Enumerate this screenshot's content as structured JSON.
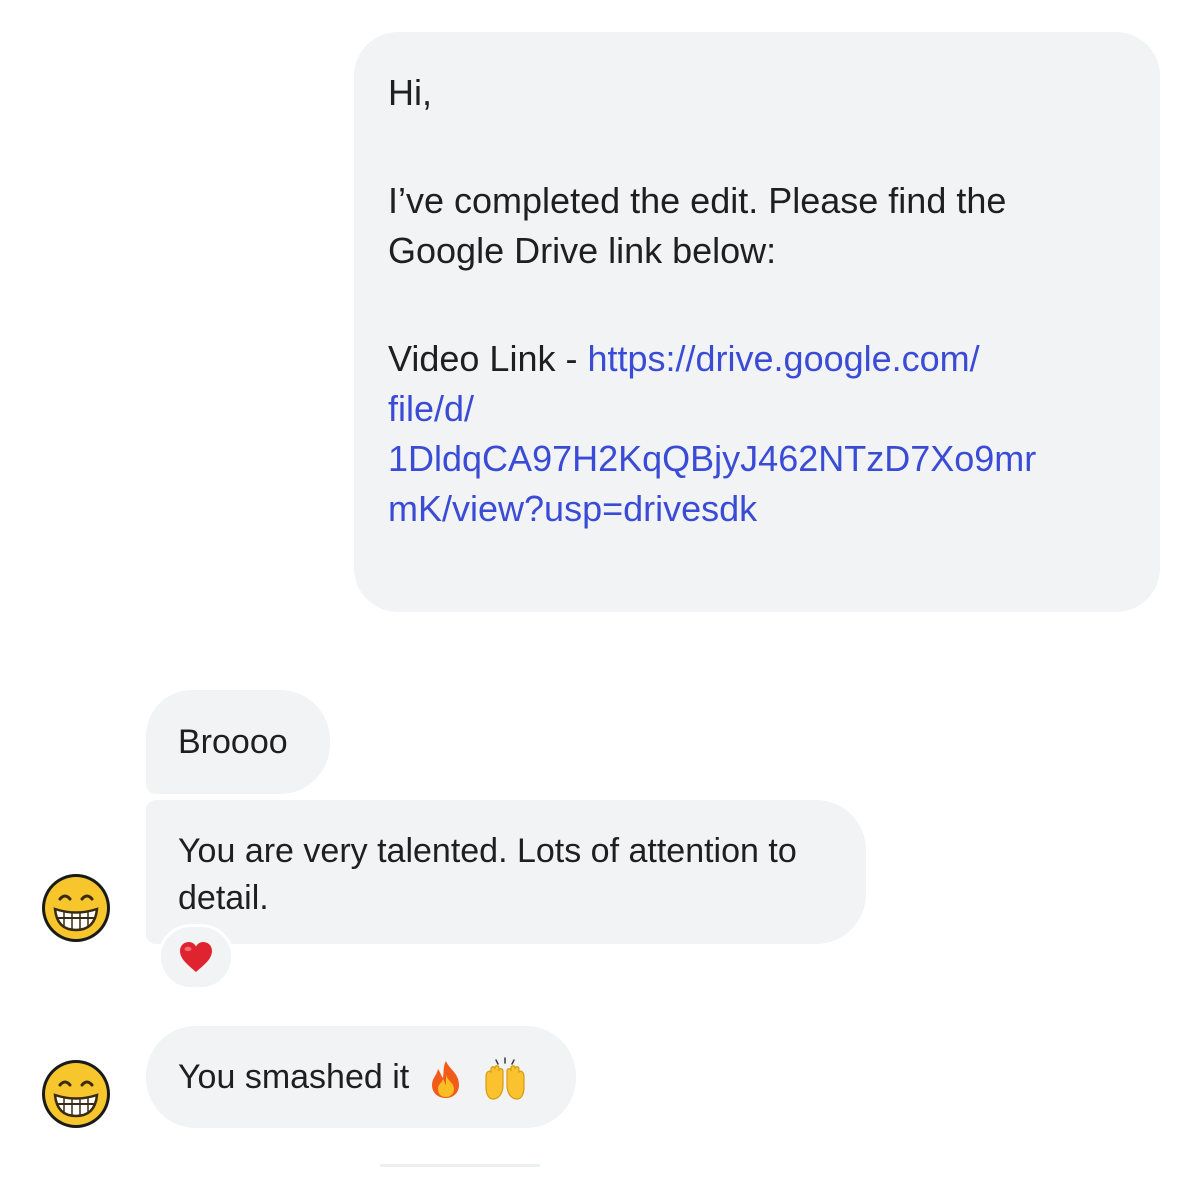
{
  "outgoing_message": {
    "greeting": "Hi,",
    "body": "I’ve completed the edit. Please find the Google Drive link below:",
    "link_prefix": "Video Link - ",
    "link_lines": [
      "https://drive.google.com/",
      "file/d/",
      "1DldqCA97H2KqQBjyJ462NTzD7Xo9mr",
      "mK/view?usp=drivesdk"
    ]
  },
  "incoming_messages": [
    {
      "text": "Broooo"
    },
    {
      "text": "You are very talented. Lots of attention to detail.",
      "reaction": "heart-icon"
    },
    {
      "text": "You smashed it",
      "emojis": [
        "fire-icon",
        "raising-hands-icon"
      ]
    }
  ],
  "avatar": {
    "icon": "grinning-face-icon"
  },
  "colors": {
    "bubble": "#f1f3f4",
    "link": "#3a4bd6",
    "text": "#1f1f1f"
  }
}
